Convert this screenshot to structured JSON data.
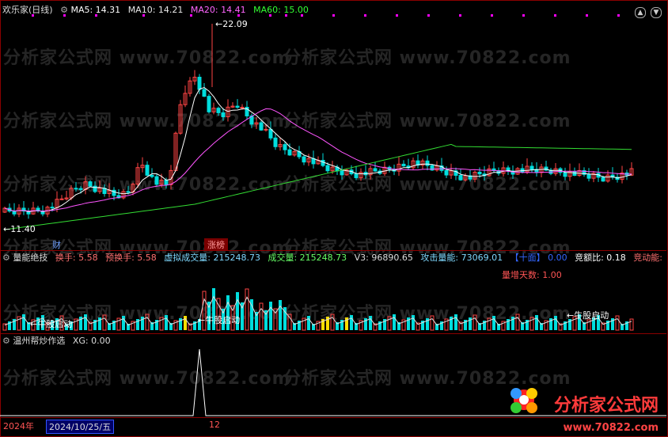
{
  "header": {
    "title": "欢乐家(日线)",
    "ma5": "MA5: 14.31",
    "ma10": "MA10: 14.21",
    "ma20": "MA20: 14.41",
    "ma60": "MA60: 15.00",
    "colors": {
      "ma5": "#ffffff",
      "ma10": "#e8e8e8",
      "ma20": "#ff66ff",
      "ma60": "#33ff33"
    }
  },
  "price_chart": {
    "high_label": "22.09",
    "low_label": "11.40",
    "tag_cai": "财",
    "tag_zb": "涨榜"
  },
  "volume_panel": {
    "title": "量能绝技",
    "huanshou": "换手: 5.58",
    "yu_huanshou": "预换手: 5.58",
    "xuni": "虚拟成交量: 215248.73",
    "chengjiao": "成交量: 215248.73",
    "v3": "V3: 96890.65",
    "gongji": "攻击量能: 73069.01",
    "shimian": "【十面】 0.00",
    "jinge": "竞额比: 0.18",
    "jindong": "竞动能:",
    "liangzeng": "量增天数: 1.00",
    "annot1": "牛股启动",
    "annot2": "牛股启动",
    "annot3": "牛股启动"
  },
  "signal_panel": {
    "title": "温州帮炒作选",
    "xg": "XG: 0.00"
  },
  "bottom": {
    "year": "2024年",
    "date": "2024/10/25/五",
    "tick": "12"
  },
  "watermark": "分析家公式网  www.70822.com",
  "logo": {
    "text": "分析家公式网",
    "url": "www.70822.com"
  }
}
